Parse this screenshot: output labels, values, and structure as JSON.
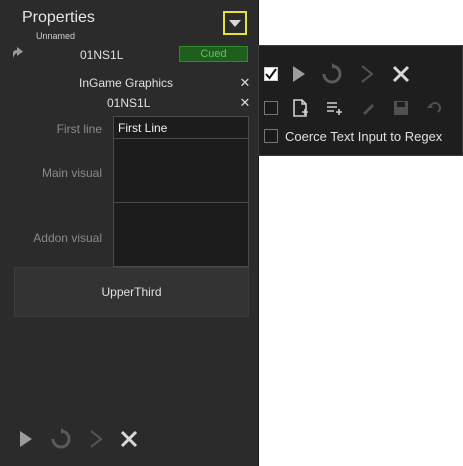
{
  "header": {
    "title": "Properties",
    "subtitle": "Unnamed"
  },
  "item": {
    "name": "01NS1L",
    "status": "Cued",
    "status_color": "#5fc35f"
  },
  "template": {
    "name": "InGame Graphics",
    "layer": "01NS1L"
  },
  "fields": [
    {
      "label": "First line",
      "value": "First Line"
    },
    {
      "label": "Main visual",
      "value": ""
    },
    {
      "label": "Addon visual",
      "value": ""
    }
  ],
  "preset_button": {
    "label": "UpperThird"
  },
  "bottom_toolbar": {
    "icons": [
      "play-icon",
      "update-icon",
      "next-icon",
      "stop-icon"
    ]
  },
  "dropdown_menu": {
    "row1_checked": true,
    "row1_icons": [
      "play-icon",
      "update-icon",
      "next-icon",
      "stop-icon"
    ],
    "row2_checked": false,
    "row2_icons": [
      "new-document-icon",
      "add-list-icon",
      "edit-icon",
      "save-icon",
      "undo-icon"
    ],
    "regex_checked": false,
    "regex_label": "Coerce Text Input to Regex"
  },
  "colors": {
    "accent_highlight": "#e8e13b",
    "panel_bg": "#2b2b2b"
  }
}
